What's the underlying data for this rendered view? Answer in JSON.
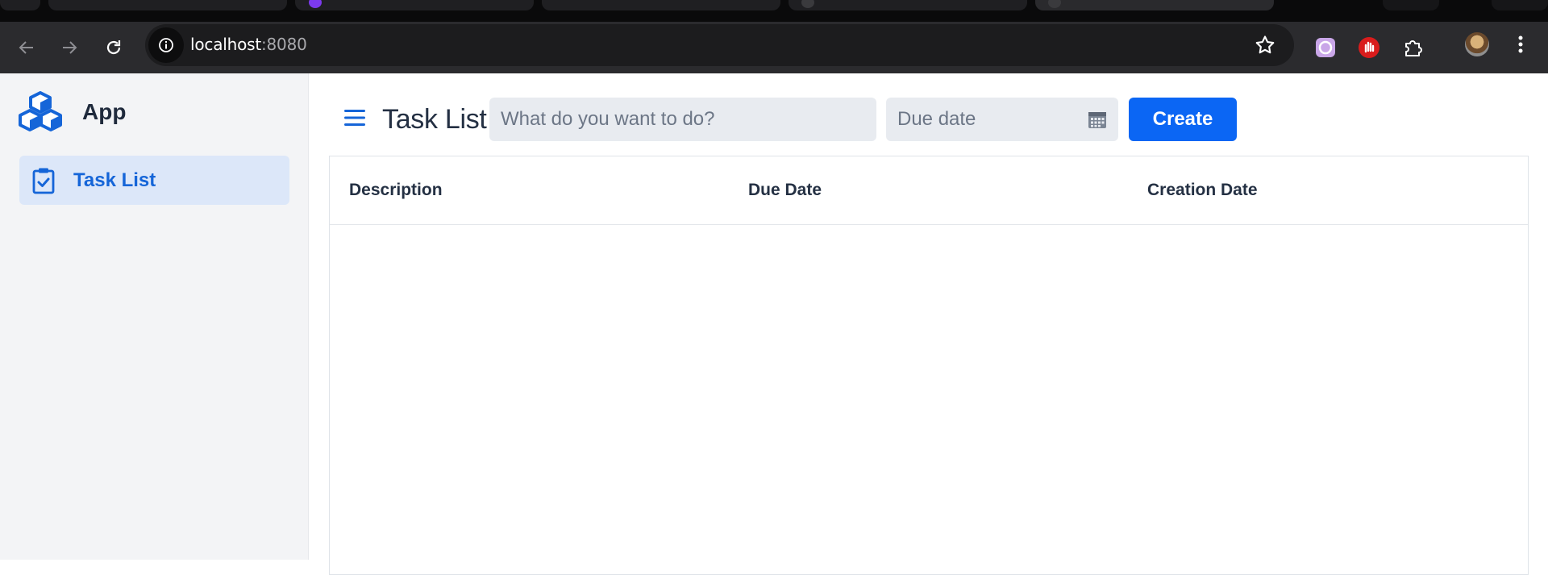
{
  "browser": {
    "url_host": "localhost",
    "url_port": ":8080",
    "icons": {
      "back": "arrow-left-icon",
      "forward": "arrow-right-icon",
      "reload": "reload-icon",
      "site_info": "info-icon",
      "bookmark": "star-icon",
      "extensions": "puzzle-icon",
      "menu": "kebab-icon"
    }
  },
  "sidebar": {
    "app_name": "App",
    "items": [
      {
        "label": "Task List",
        "icon": "clipboard-check-icon",
        "active": true
      }
    ]
  },
  "header": {
    "title": "Task List",
    "task_placeholder": "What do you want to do?",
    "date_placeholder": "Due date",
    "create_label": "Create"
  },
  "grid": {
    "columns": [
      "Description",
      "Due Date",
      "Creation Date"
    ],
    "rows": []
  },
  "colors": {
    "accent": "#0b66f4",
    "sidebar_bg": "#f3f4f6",
    "active_item_bg": "#dce7f9",
    "field_bg": "#e8ebf0",
    "chrome_toolbar": "#2b2b2e"
  }
}
